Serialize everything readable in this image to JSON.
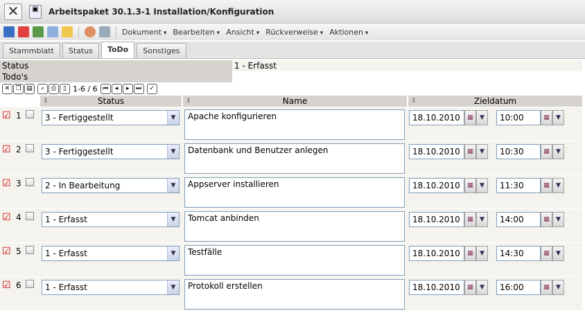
{
  "window": {
    "title": "Arbeitspaket 30.1.3-1 Installation/Konfiguration"
  },
  "toolbar": {
    "menus": [
      "Dokument",
      "Bearbeiten",
      "Ansicht",
      "Rückverweise",
      "Aktionen"
    ]
  },
  "tabs": [
    {
      "label": "Stammblatt"
    },
    {
      "label": "Status"
    },
    {
      "label": "ToDo",
      "active": true
    },
    {
      "label": "Sonstiges"
    }
  ],
  "fields": {
    "status_label": "Status",
    "status_value": "1 - Erfasst",
    "todos_label": "Todo's"
  },
  "nav": {
    "range": "1-6 / 6"
  },
  "columns": {
    "status": "Status",
    "name": "Name",
    "date": "Zieldatum"
  },
  "rows": [
    {
      "num": "1",
      "status": "3 - Fertiggestellt",
      "name": "Apache konfigurieren",
      "date": "18.10.2010",
      "time": "10:00"
    },
    {
      "num": "2",
      "status": "3 - Fertiggestellt",
      "name": "Datenbank und Benutzer anlegen",
      "date": "18.10.2010",
      "time": "10:30"
    },
    {
      "num": "3",
      "status": "2 - In Bearbeitung",
      "name": "Appserver installieren",
      "date": "18.10.2010",
      "time": "11:30"
    },
    {
      "num": "4",
      "status": "1 - Erfasst",
      "name": "Tomcat anbinden",
      "date": "18.10.2010",
      "time": "14:00"
    },
    {
      "num": "5",
      "status": "1 - Erfasst",
      "name": "Testfälle",
      "date": "18.10.2010",
      "time": "14:30"
    },
    {
      "num": "6",
      "status": "1 - Erfasst",
      "name": "Protokoll erstellen",
      "date": "18.10.2010",
      "time": "16:00"
    }
  ]
}
